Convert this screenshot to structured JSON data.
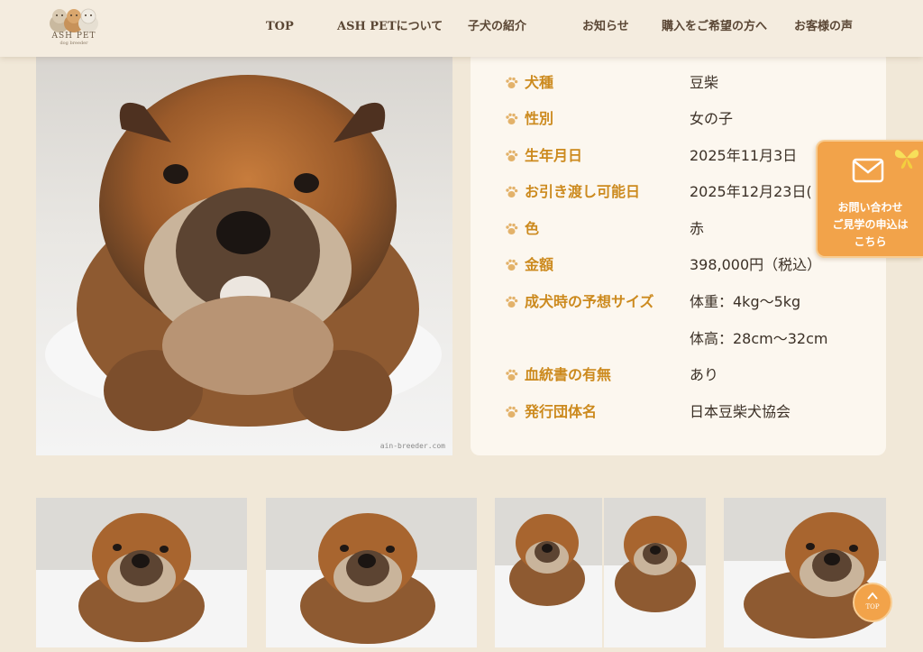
{
  "header": {
    "logo_text": "ASH PET",
    "logo_sub": "dog breeder",
    "nav": [
      "TOP",
      "ASH PETについて",
      "子犬の紹介",
      "お知らせ",
      "購入をご希望の方へ",
      "お客様の声"
    ]
  },
  "photo": {
    "watermark": "ain-breeder.com"
  },
  "info": {
    "rows": [
      {
        "label": "犬種",
        "value": "豆柴"
      },
      {
        "label": "性別",
        "value": "女の子"
      },
      {
        "label": "生年月日",
        "value": "2025年11月3日"
      },
      {
        "label": "お引き渡し可能日",
        "value": "2025年12月23日("
      },
      {
        "label": "色",
        "value": "赤"
      },
      {
        "label": "金額",
        "value": "398,000円（税込）"
      },
      {
        "label": "成犬時の予想サイズ",
        "value": "体重：4kg〜5kg"
      },
      {
        "label": "",
        "value": "体高：28cm〜32cm"
      },
      {
        "label": "血統書の有無",
        "value": "あり"
      },
      {
        "label": "発行団体名",
        "value": "日本豆柴犬協会"
      }
    ]
  },
  "contact": {
    "line1": "お問い合わせ",
    "line2": "ご見学の申込は",
    "line3": "こちら",
    "icons": [
      "mail-icon",
      "butterfly-icon"
    ]
  },
  "back_to_top": {
    "label": "TOP"
  },
  "colors": {
    "background": "#f1e8d8",
    "card": "#fcf7ef",
    "label_accent": "#cc8a1e",
    "contact_orange": "#f2a34a"
  }
}
